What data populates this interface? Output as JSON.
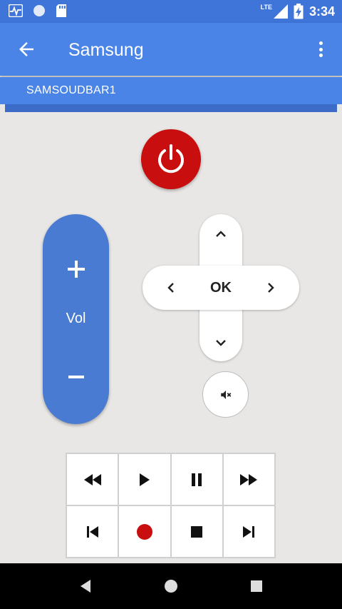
{
  "status_bar": {
    "network_label": "LTE",
    "time": "3:34",
    "icons": [
      "pulse-icon",
      "circle-icon",
      "sd-card-icon",
      "signal-icon",
      "battery-charging-icon"
    ]
  },
  "app_bar": {
    "title": "Samsung",
    "back_icon": "arrow-back-icon",
    "menu_icon": "more-vert-icon"
  },
  "device": {
    "name": "SAMSOUDBAR1"
  },
  "remote": {
    "power_icon": "power-icon",
    "volume": {
      "label": "Vol",
      "up_icon": "plus-icon",
      "down_icon": "minus-icon"
    },
    "dpad": {
      "ok_label": "OK",
      "up_icon": "chevron-up-icon",
      "down_icon": "chevron-down-icon",
      "left_icon": "chevron-left-icon",
      "right_icon": "chevron-right-icon"
    },
    "mute_icon": "volume-off-icon",
    "media_buttons": [
      "rewind-icon",
      "play-icon",
      "pause-icon",
      "fast-forward-icon",
      "skip-previous-icon",
      "record-icon",
      "stop-icon",
      "skip-next-icon"
    ]
  },
  "colors": {
    "primary": "#4a84e6",
    "status": "#3f74d8",
    "power": "#c80e0e",
    "volume": "#4a7bd2",
    "record": "#c80e0e",
    "background": "#e9e7e5"
  },
  "nav_bar": {
    "icons": [
      "nav-back-icon",
      "nav-home-icon",
      "nav-recents-icon"
    ]
  }
}
